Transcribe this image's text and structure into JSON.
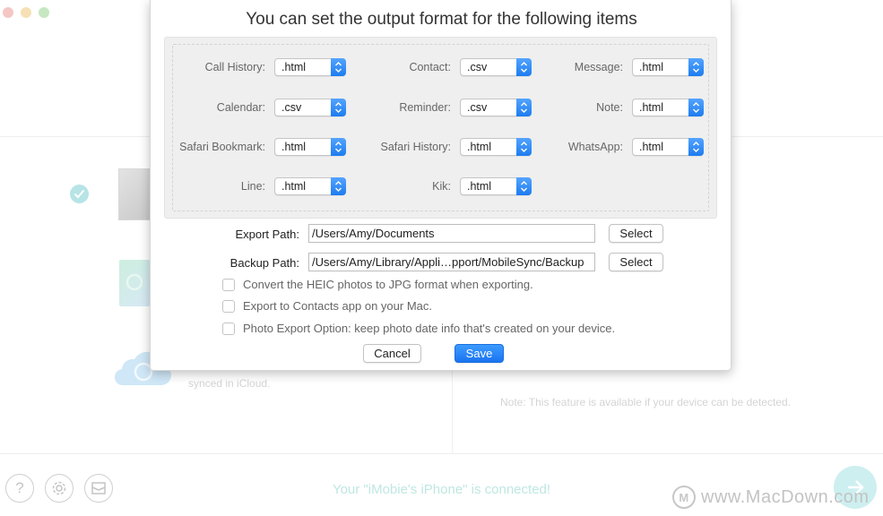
{
  "window": {
    "traffic_lights": [
      "close",
      "minimize",
      "maximize"
    ]
  },
  "background": {
    "icloud_text": "synced in iCloud.",
    "note_text": "Note: This feature is available if your device can be detected.",
    "status_text": "Your \"iMobie's iPhone\" is connected!",
    "footer_icons": [
      "help-icon",
      "settings-icon",
      "mail-icon"
    ],
    "watermark_text": "www.MacDown.com",
    "watermark_logo": "M"
  },
  "dialog": {
    "title": "You can set the output format for the following items",
    "formats": [
      {
        "label": "Call History:",
        "value": ".html"
      },
      {
        "label": "Contact:",
        "value": ".csv"
      },
      {
        "label": "Message:",
        "value": ".html"
      },
      {
        "label": "Calendar:",
        "value": ".csv"
      },
      {
        "label": "Reminder:",
        "value": ".csv"
      },
      {
        "label": "Note:",
        "value": ".html"
      },
      {
        "label": "Safari Bookmark:",
        "value": ".html"
      },
      {
        "label": "Safari History:",
        "value": ".html"
      },
      {
        "label": "WhatsApp:",
        "value": ".html"
      },
      {
        "label": "Line:",
        "value": ".html"
      },
      {
        "label": "Kik:",
        "value": ".html"
      }
    ],
    "export_path": {
      "label": "Export Path:",
      "value": "/Users/Amy/Documents",
      "button": "Select"
    },
    "backup_path": {
      "label": "Backup Path:",
      "value": "/Users/Amy/Library/Appli…pport/MobileSync/Backup",
      "button": "Select"
    },
    "options": [
      {
        "label": "Convert the HEIC photos to JPG format when exporting.",
        "checked": false
      },
      {
        "label": "Export to Contacts app on your Mac.",
        "checked": false
      },
      {
        "label": "Photo Export Option: keep photo date info that's created on your device.",
        "checked": false
      }
    ],
    "cancel_label": "Cancel",
    "save_label": "Save"
  },
  "colors": {
    "accent": "#1d7cf0",
    "status_teal": "#bfe7e1"
  }
}
